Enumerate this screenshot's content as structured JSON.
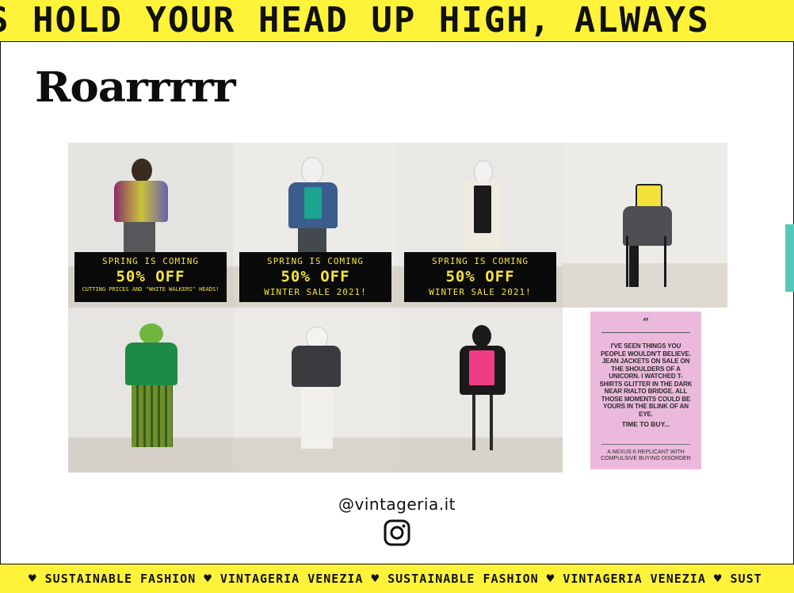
{
  "top_marquee": {
    "text": "S   HOLD YOUR HEAD UP HIGH, ALWAYS"
  },
  "section": {
    "title": "Roarrrrr"
  },
  "posts": [
    {
      "caption_top": "SPRING IS COMING",
      "caption_mid": "50% OFF",
      "caption_bot": "CUTTING PRICES AND \"WHITE WALKERS\" HEADS!"
    },
    {
      "caption_top": "SPRING IS COMING",
      "caption_mid": "50% OFF",
      "caption_bot": "WINTER SALE 2021!"
    },
    {
      "caption_top": "SPRING IS COMING",
      "caption_mid": "50% OFF",
      "caption_bot": "WINTER SALE 2021!"
    }
  ],
  "quote_card": {
    "mark": "“",
    "text": "I'VE SEEN THINGS YOU PEOPLE WOULDN'T BELIEVE. JEAN JACKETS ON SALE ON THE SHOULDERS OF A UNICORN. I WATCHED T-SHIRTS GLITTER IN THE DARK NEAR RIALTO BRIDGE. ALL THOSE MOMENTS COULD BE YOURS IN THE BLINK OF AN EYE.",
    "cta": "TIME TO BUY...",
    "signature": "A NEXUS-6 REPLICANT WITH COMPULSIVE BUYING DISORDER"
  },
  "social": {
    "handle": "@vintageria.it",
    "icon": "instagram-icon"
  },
  "bottom_marquee": {
    "items": [
      "SUSTAINABLE FASHION",
      "VINTAGERIA VENEZIA",
      "SUSTAINABLE FASHION",
      "VINTAGERIA VENEZIA",
      "SUST"
    ]
  },
  "colors": {
    "accent_yellow": "#fff33a",
    "sale_text": "#f3e340",
    "quote_pink": "#ebb9dc",
    "side_tab": "#55c9b9"
  }
}
